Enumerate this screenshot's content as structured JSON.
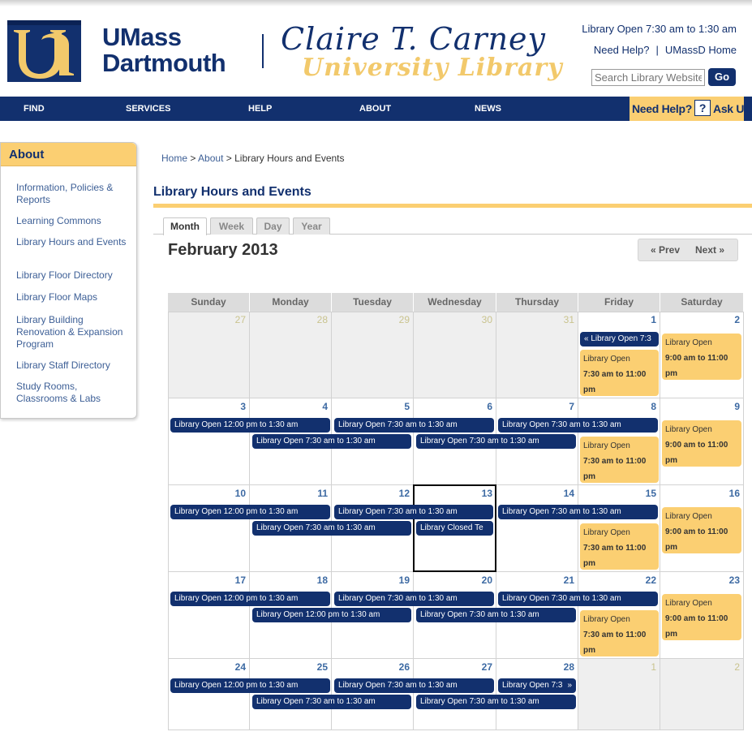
{
  "header": {
    "umass_line1": "UMass",
    "umass_line2": "Dartmouth",
    "library_name": "Claire T. Carney",
    "library_sub": "University Library",
    "hours_status": "Library Open 7:30 am to 1:30 am",
    "need_help": "Need Help?",
    "link_sep": "|",
    "umassd_home": "UMassD Home",
    "search_placeholder": "Search Library Website",
    "go_label": "Go"
  },
  "nav": {
    "items": [
      "FIND",
      "SERVICES",
      "HELP",
      "ABOUT",
      "NEWS"
    ],
    "askus_need": "Need Help?",
    "askus_q": "?",
    "askus_ask": "Ask Us!"
  },
  "sidebar": {
    "heading": "About",
    "items": [
      "Information, Policies & Reports",
      "Learning Commons",
      "Library Hours and Events",
      "Library Floor Directory",
      "Library Floor Maps",
      "Library Building Renovation & Expansion Program",
      "Library Staff Directory",
      "Study Rooms, Classrooms & Labs"
    ]
  },
  "breadcrumb": {
    "home": "Home",
    "sep1": ">",
    "about": "About",
    "sep2": ">",
    "current": "Library Hours and Events"
  },
  "page_title": "Library Hours and Events",
  "view_tabs": [
    "Month",
    "Week",
    "Day",
    "Year"
  ],
  "active_tab": "Month",
  "calendar": {
    "month_title": "February 2013",
    "prev_label": "« Prev",
    "next_label": "Next »",
    "day_headers": [
      "Sunday",
      "Monday",
      "Tuesday",
      "Wednesday",
      "Thursday",
      "Friday",
      "Saturday"
    ],
    "weeks": [
      [
        "27",
        "28",
        "29",
        "30",
        "31",
        "1",
        "2"
      ],
      [
        "3",
        "4",
        "5",
        "6",
        "7",
        "8",
        "9"
      ],
      [
        "10",
        "11",
        "12",
        "13",
        "14",
        "15",
        "16"
      ],
      [
        "17",
        "18",
        "19",
        "20",
        "21",
        "22",
        "23"
      ],
      [
        "24",
        "25",
        "26",
        "27",
        "28",
        "1",
        "2"
      ]
    ],
    "today": "13",
    "events": {
      "open_1200": "Library Open 12:00 pm to 1:30 am",
      "open_730": "Library Open 7:30 am to 1:30 am",
      "closed": "Library Closed Te",
      "cont_fri1": "« Library Open 7:3",
      "cont_thu28": "Library Open 7:3",
      "cont_arrow": "»",
      "fri_label": "Library Open",
      "fri_hours": "7:30 am to 11:00 pm",
      "sat_label": "Library Open",
      "sat_hours": "9:00 am to 11:00 pm"
    }
  },
  "colors": {
    "navy": "#12306e",
    "gold": "#fbcf72",
    "link_blue": "#3d5f96"
  }
}
